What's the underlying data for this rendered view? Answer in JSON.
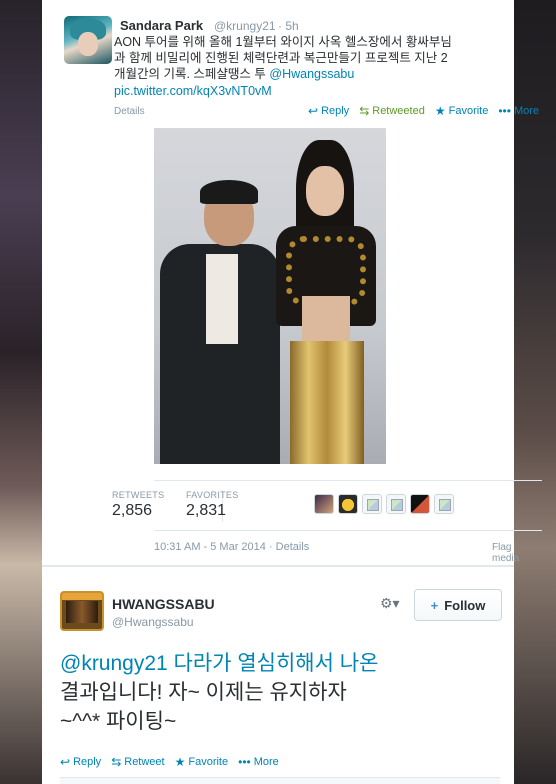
{
  "tweet": {
    "author_name": "Sandara Park",
    "author_handle": "@krungy21",
    "time_ago": "· 5h",
    "text_line1": "AON 투어를 위해 올해 1월부터 와이지 사옥 헬스장에서 황싸부님",
    "text_line2": "과 함께 비밀리에 진행된 체력단련과 복근만들기 프로젝트 지난 2",
    "text_line3": "개월간의 기록. 스페샬땡스 투 ",
    "mention": "@Hwangssabu",
    "pic_link": "pic.twitter.com/kqX3vNT0vM",
    "details": "Details",
    "actions": {
      "reply": "Reply",
      "retweeted": "Retweeted",
      "favorite": "Favorite",
      "more": "More"
    },
    "stats": {
      "retweets_label": "RETWEETS",
      "retweets": "2,856",
      "favorites_label": "FAVORITES",
      "favorites": "2,831"
    },
    "timestamp": "10:31 AM - 5 Mar 2014 · Details",
    "flag_media": "Flag media"
  },
  "reply": {
    "author_name": "HWANGSSABU",
    "author_handle": "@Hwangssabu",
    "follow_label": "Follow",
    "gear_label": "⚙▾",
    "text_line1": "@krungy21 다라가 열심히해서 나온",
    "text_line2": "결과입니다! 자~ 이제는 유지하자",
    "text_line3": "~^^* 파이팅~",
    "actions": {
      "reply": "Reply",
      "retweet": "Retweet",
      "favorite": "Favorite",
      "more": "More"
    }
  },
  "icons": {
    "reply": "↩",
    "retweet": "⇆",
    "favorite": "★",
    "more": "•••",
    "plus_user": "+"
  },
  "colors": {
    "link": "#0084b4",
    "retweeted": "#609928",
    "text": "#292f33",
    "muted": "#8899a6"
  }
}
